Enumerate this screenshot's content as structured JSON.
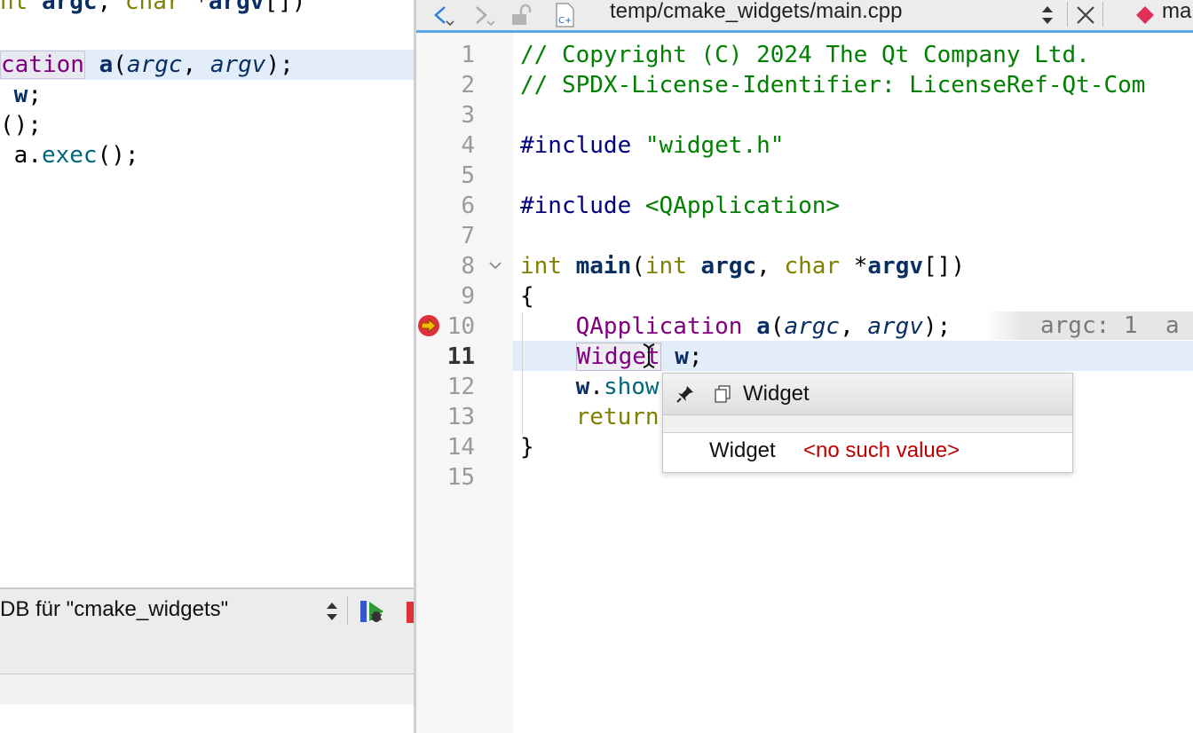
{
  "left_editor": {
    "lines": [
      {
        "tokens": [
          {
            "t": "nt ",
            "c": "kw"
          },
          {
            "t": "argc",
            "c": "id"
          },
          {
            "t": ", ",
            "c": "op"
          },
          {
            "t": "char",
            "c": "kw"
          },
          {
            "t": " *",
            "c": "op"
          },
          {
            "t": "argv",
            "c": "id"
          },
          {
            "t": "[])",
            "c": "op"
          }
        ]
      },
      {
        "tokens": [
          {
            "t": "cation",
            "c": "ty",
            "box": true
          },
          {
            "t": " ",
            "c": "op"
          },
          {
            "t": "a",
            "c": "id"
          },
          {
            "t": "(",
            "c": "op"
          },
          {
            "t": "argc",
            "c": "par"
          },
          {
            "t": ", ",
            "c": "op"
          },
          {
            "t": "argv",
            "c": "par"
          },
          {
            "t": ");",
            "c": "op"
          }
        ]
      },
      {
        "tokens": [
          {
            "t": " w",
            "c": "id"
          },
          {
            "t": ";",
            "c": "op"
          }
        ]
      },
      {
        "tokens": [
          {
            "t": "();",
            "c": "op"
          }
        ]
      },
      {
        "tokens": [
          {
            "t": " a",
            "c": "op"
          },
          {
            "t": ".",
            "c": "op"
          },
          {
            "t": "exec",
            "c": "fn"
          },
          {
            "t": "();",
            "c": "op"
          }
        ]
      }
    ],
    "debugger_selector": "DB für \"cmake_widgets\""
  },
  "toolbar": {
    "file_path": "temp/cmake_widgets/main.cpp",
    "split_label": "ma",
    "icons": [
      "back-arrow-icon",
      "forward-arrow-icon",
      "lock-icon",
      "cpp-file-icon",
      "updown-arrows-icon",
      "close-icon",
      "diamond-icon"
    ]
  },
  "editor": {
    "current_line": 11,
    "breakpoint_line": 10,
    "fold_line": 8,
    "lines": [
      {
        "n": 1,
        "tokens": [
          {
            "t": "// Copyright (C) 2024 The Qt Company Ltd.",
            "c": "cmt"
          }
        ]
      },
      {
        "n": 2,
        "tokens": [
          {
            "t": "// SPDX-License-Identifier: LicenseRef-Qt-Com",
            "c": "cmt"
          }
        ]
      },
      {
        "n": 3,
        "tokens": []
      },
      {
        "n": 4,
        "tokens": [
          {
            "t": "#include ",
            "c": "pp"
          },
          {
            "t": "\"widget.h\"",
            "c": "str"
          }
        ]
      },
      {
        "n": 5,
        "tokens": []
      },
      {
        "n": 6,
        "tokens": [
          {
            "t": "#include ",
            "c": "pp"
          },
          {
            "t": "<QApplication>",
            "c": "str"
          }
        ]
      },
      {
        "n": 7,
        "tokens": []
      },
      {
        "n": 8,
        "tokens": [
          {
            "t": "int",
            "c": "kw"
          },
          {
            "t": " ",
            "c": "op"
          },
          {
            "t": "main",
            "c": "id"
          },
          {
            "t": "(",
            "c": "op"
          },
          {
            "t": "int",
            "c": "kw"
          },
          {
            "t": " ",
            "c": "op"
          },
          {
            "t": "argc",
            "c": "id"
          },
          {
            "t": ", ",
            "c": "op"
          },
          {
            "t": "char",
            "c": "kw"
          },
          {
            "t": " *",
            "c": "op"
          },
          {
            "t": "argv",
            "c": "id"
          },
          {
            "t": "[])",
            "c": "op"
          }
        ]
      },
      {
        "n": 9,
        "tokens": [
          {
            "t": "{",
            "c": "op"
          }
        ]
      },
      {
        "n": 10,
        "tokens": [
          {
            "t": "    ",
            "c": "op"
          },
          {
            "t": "QApplication",
            "c": "ty"
          },
          {
            "t": " ",
            "c": "op"
          },
          {
            "t": "a",
            "c": "id"
          },
          {
            "t": "(",
            "c": "op"
          },
          {
            "t": "argc",
            "c": "par"
          },
          {
            "t": ", ",
            "c": "op"
          },
          {
            "t": "argv",
            "c": "par"
          },
          {
            "t": ");",
            "c": "op"
          }
        ]
      },
      {
        "n": 11,
        "tokens": [
          {
            "t": "    ",
            "c": "op"
          },
          {
            "t": "Widget",
            "c": "ty",
            "box": true
          },
          {
            "t": " ",
            "c": "op"
          },
          {
            "t": "w",
            "c": "id"
          },
          {
            "t": ";",
            "c": "op"
          }
        ]
      },
      {
        "n": 12,
        "tokens": [
          {
            "t": "    ",
            "c": "op"
          },
          {
            "t": "w",
            "c": "id"
          },
          {
            "t": ".",
            "c": "op"
          },
          {
            "t": "show",
            "c": "fn"
          }
        ]
      },
      {
        "n": 13,
        "tokens": [
          {
            "t": "    ",
            "c": "op"
          },
          {
            "t": "return",
            "c": "kw"
          }
        ]
      },
      {
        "n": 14,
        "tokens": [
          {
            "t": "}",
            "c": "op"
          }
        ]
      },
      {
        "n": 15,
        "tokens": []
      }
    ],
    "inline_value": "argc: 1  a"
  },
  "tooltip": {
    "title": "Widget",
    "name": "Widget",
    "value": "<no such value>"
  },
  "colors": {
    "accent": "#5aa6e6",
    "current_line": "#e3edf9",
    "comment": "#008000",
    "keyword": "#808000",
    "type": "#800080",
    "error": "#c00000",
    "breakpoint": "#e0303a"
  }
}
